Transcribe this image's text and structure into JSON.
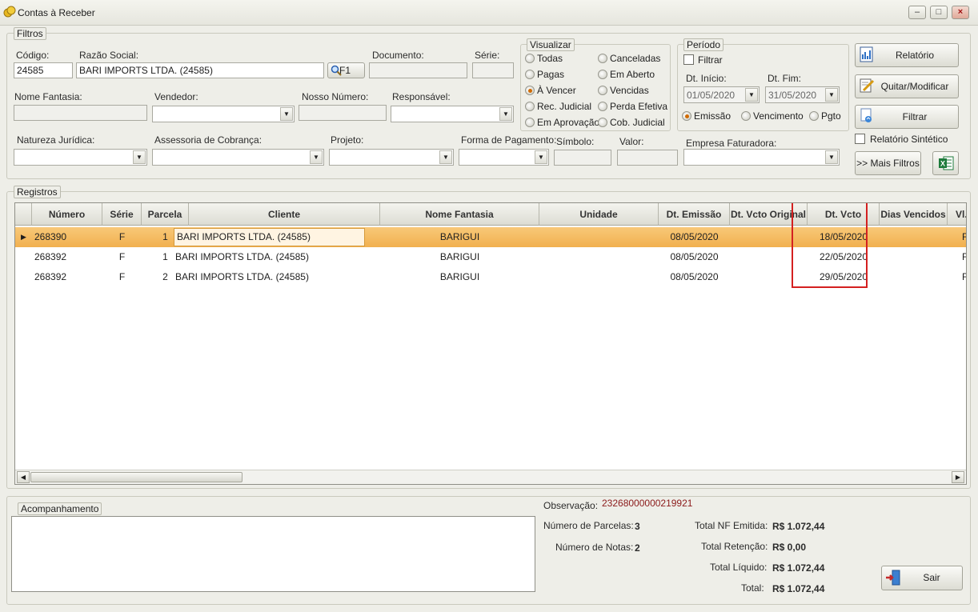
{
  "window": {
    "title": "Contas à Receber",
    "min": "–",
    "max": "□",
    "close": "×"
  },
  "filtros": {
    "legend": "Filtros",
    "codigo": {
      "label": "Código:",
      "value": "24585"
    },
    "razao_social": {
      "label": "Razão Social:",
      "value": "BARI IMPORTS LTDA. (24585)",
      "search_btn": "F1"
    },
    "documento": {
      "label": "Documento:",
      "value": ""
    },
    "serie": {
      "label": "Série:",
      "value": ""
    },
    "nome_fantasia": {
      "label": "Nome Fantasia:",
      "value": ""
    },
    "vendedor": {
      "label": "Vendedor:",
      "value": ""
    },
    "nosso_numero": {
      "label": "Nosso Número:",
      "value": ""
    },
    "responsavel": {
      "label": "Responsável:",
      "value": ""
    },
    "natureza_juridica": {
      "label": "Natureza Jurídica:",
      "value": ""
    },
    "assessoria": {
      "label": "Assessoria de Cobrança:",
      "value": ""
    },
    "projeto": {
      "label": "Projeto:",
      "value": ""
    },
    "forma_pagamento": {
      "label": "Forma de Pagamento:",
      "value": ""
    },
    "simbolo": {
      "label": "Símbolo:",
      "value": ""
    },
    "valor": {
      "label": "Valor:",
      "value": ""
    },
    "empresa_faturadora": {
      "label": "Empresa Faturadora:",
      "value": ""
    }
  },
  "visualizar": {
    "legend": "Visualizar",
    "options": [
      "Todas",
      "Canceladas",
      "Pagas",
      "Em Aberto",
      "À Vencer",
      "Vencidas",
      "Rec. Judicial",
      "Perda Efetiva",
      "Em Aprovação",
      "Cob. Judicial"
    ],
    "selected": "À Vencer"
  },
  "periodo": {
    "legend": "Período",
    "filtrar": "Filtrar",
    "dt_inicio": {
      "label": "Dt. Início:",
      "value": "01/05/2020"
    },
    "dt_fim": {
      "label": "Dt. Fim:",
      "value": "31/05/2020"
    },
    "options": [
      "Emissão",
      "Vencimento",
      "Pgto"
    ],
    "selected": "Emissão"
  },
  "buttons": {
    "relatorio": "Relatório",
    "quitar": "Quitar/Modificar",
    "filtrar": "Filtrar",
    "relatorio_sintetico": "Relatório Sintético",
    "mais_filtros": ">> Mais Filtros",
    "sair": "Sair"
  },
  "registros": {
    "legend": "Registros",
    "columns": [
      "Número",
      "Série",
      "Parcela",
      "Cliente",
      "Nome Fantasia",
      "Unidade",
      "Dt. Emissão",
      "Dt. Vcto Original",
      "Dt. Vcto",
      "Dias Vencidos",
      "Vl. To"
    ],
    "rows": [
      {
        "numero": "268390",
        "serie": "F",
        "parcela": "1",
        "cliente": "BARI IMPORTS LTDA. (24585)",
        "fantasia": "BARIGUI",
        "unidade": "",
        "emissao": "08/05/2020",
        "vcto_original": "",
        "vcto": "18/05/2020",
        "dias": "",
        "vl": "F"
      },
      {
        "numero": "268392",
        "serie": "F",
        "parcela": "1",
        "cliente": "BARI IMPORTS LTDA. (24585)",
        "fantasia": "BARIGUI",
        "unidade": "",
        "emissao": "08/05/2020",
        "vcto_original": "",
        "vcto": "22/05/2020",
        "dias": "",
        "vl": "F"
      },
      {
        "numero": "268392",
        "serie": "F",
        "parcela": "2",
        "cliente": "BARI IMPORTS LTDA. (24585)",
        "fantasia": "BARIGUI",
        "unidade": "",
        "emissao": "08/05/2020",
        "vcto_original": "",
        "vcto": "29/05/2020",
        "dias": "",
        "vl": "F"
      }
    ]
  },
  "acompanhamento": {
    "legend": "Acompanhamento"
  },
  "resumo": {
    "observacao": {
      "label": "Observação:",
      "value": "23268000000219921"
    },
    "num_parcelas": {
      "label": "Número de Parcelas:",
      "value": "3"
    },
    "num_notas": {
      "label": "Número de Notas:",
      "value": "2"
    },
    "total_nf": {
      "label": "Total NF Emitida:",
      "value": "R$ 1.072,44"
    },
    "total_retencao": {
      "label": "Total Retenção:",
      "value": "R$ 0,00"
    },
    "total_liquido": {
      "label": "Total Líquido:",
      "value": "R$ 1.072,44"
    },
    "total": {
      "label": "Total:",
      "value": "R$ 1.072,44"
    }
  },
  "colors": {
    "selected_row": "#f1b04f",
    "highlight_box": "#d42020",
    "observacao_value": "#8b1a1a"
  }
}
